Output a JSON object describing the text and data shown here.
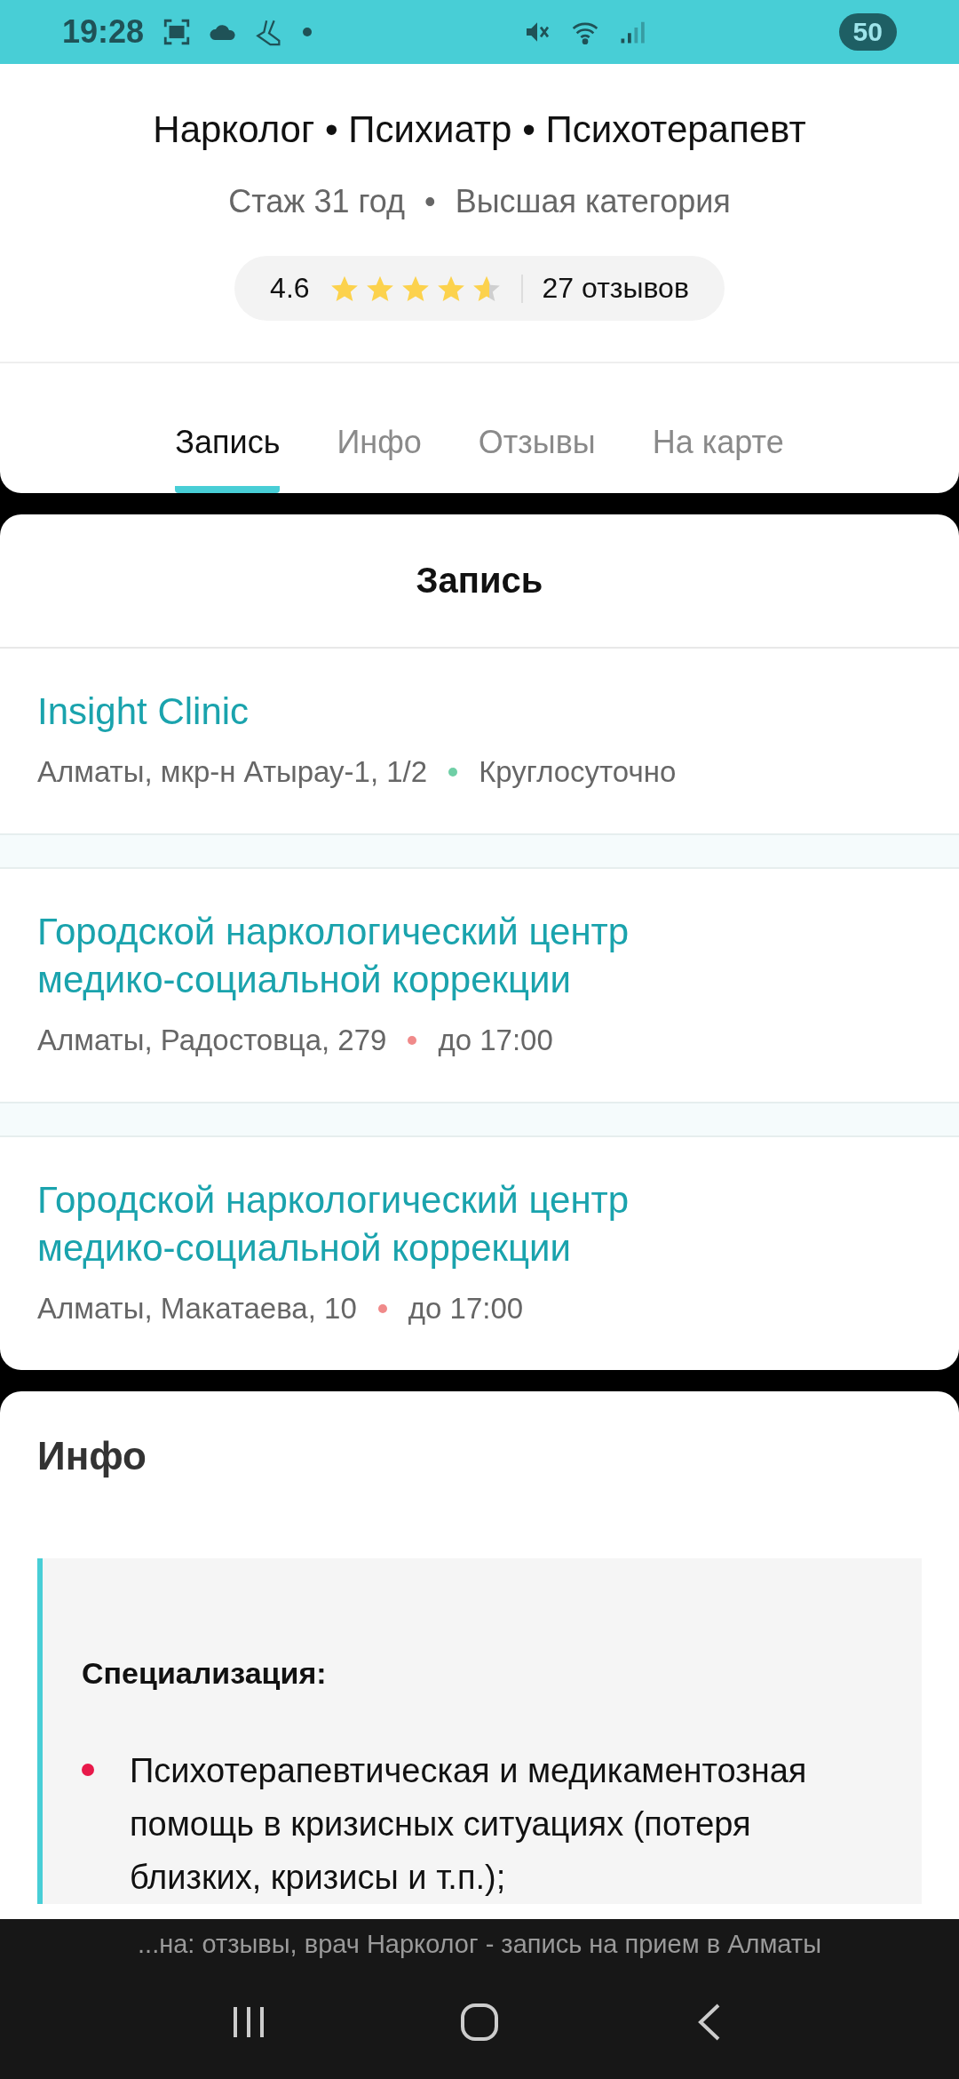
{
  "status_bar": {
    "time": "19:28",
    "battery": "50"
  },
  "doctor": {
    "specialties": "Нарколог • Психиатр • Психотерапевт",
    "experience": "Стаж 31 год",
    "separator": "•",
    "category": "Высшая категория",
    "rating": "4.6",
    "stars": 4.6,
    "reviews": "27 отзывов"
  },
  "tabs": [
    {
      "label": "Запись",
      "selected": true
    },
    {
      "label": "Инфо",
      "selected": false
    },
    {
      "label": "Отзывы",
      "selected": false
    },
    {
      "label": "На карте",
      "selected": false
    }
  ],
  "booking": {
    "title": "Запись",
    "clinics": [
      {
        "name": "Insight Clinic",
        "address": "Алматы, мкр-н Атырау-1, 1/2",
        "hours": "Круглосуточно",
        "color": "#6fcfa6"
      },
      {
        "name": "Городской наркологический центр медико-социальной коррекции",
        "address": "Алматы, Радостовца, 279",
        "hours": "до 17:00",
        "color": "#f08a8a"
      },
      {
        "name": "Городской наркологический центр медико-социальной коррекции",
        "address": "Алматы, Макатаева, 10",
        "hours": "до 17:00",
        "color": "#f08a8a"
      }
    ]
  },
  "info": {
    "title": "Инфо",
    "heading": "Специализация:",
    "items": [
      "Психотерапевтическая и медикаментозная помощь в кризисных ситуациях (потеря близких, кризисы и т.п.);"
    ]
  },
  "browser_caption": "...на: отзывы, врач Нарколог - запись на прием в Алматы"
}
